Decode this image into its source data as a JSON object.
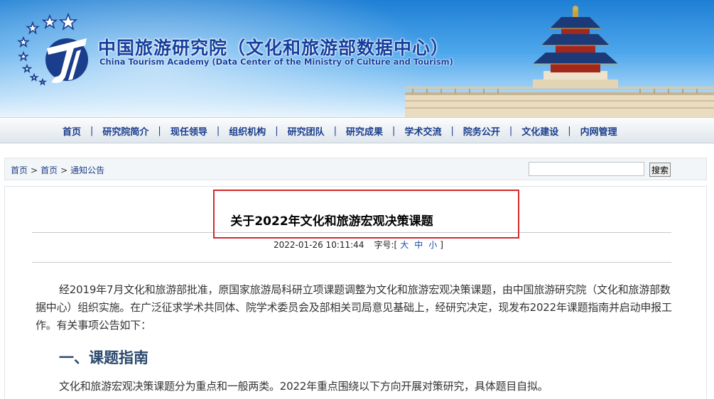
{
  "header": {
    "title_cn": "中国旅游研究院（文化和旅游部数据中心）",
    "title_en": "China Tourism Academy (Data Center of the Ministry of Culture and Tourism)",
    "logo_icon": "cta-logo-icon",
    "banner_image": "temple-of-heaven-illustration"
  },
  "nav": {
    "items": [
      {
        "label": "首页"
      },
      {
        "label": "研究院简介"
      },
      {
        "label": "现任领导"
      },
      {
        "label": "组织机构"
      },
      {
        "label": "研究团队"
      },
      {
        "label": "研究成果"
      },
      {
        "label": "学术交流"
      },
      {
        "label": "院务公开"
      },
      {
        "label": "文化建设"
      },
      {
        "label": "内网管理"
      }
    ],
    "separator": "|"
  },
  "breadcrumb": {
    "items": [
      "首页",
      "首页",
      "通知公告"
    ],
    "separator": ">"
  },
  "search": {
    "value": "",
    "button_label": "搜索"
  },
  "article": {
    "title": "关于2022年文化和旅游宏观决策课题",
    "datetime": "2022-01-26 10:11:44",
    "font_size_label": "字号:[",
    "font_large": "大",
    "font_medium": "中",
    "font_small": "小",
    "font_close": "]",
    "paragraph1": "经2019年7月文化和旅游部批准，原国家旅游局科研立项课题调整为文化和旅游宏观决策课题，由中国旅游研究院（文化和旅游部数据中心）组织实施。在广泛征求学术共同体、院学术委员会及部相关司局意见基础上，经研究决定，现发布2022年课题指南并启动申报工作。有关事项公告如下：",
    "heading1": "一、课题指南",
    "paragraph2": "文化和旅游宏观决策课题分为重点和一般两类。2022年重点围绕以下方向开展对策研究，具体题目自拟。"
  },
  "colors": {
    "nav_text": "#1a3d8c",
    "banner_blue": "#1e7fd4",
    "highlight_border": "#d42a2a",
    "heading_color": "#2c4a6e"
  }
}
